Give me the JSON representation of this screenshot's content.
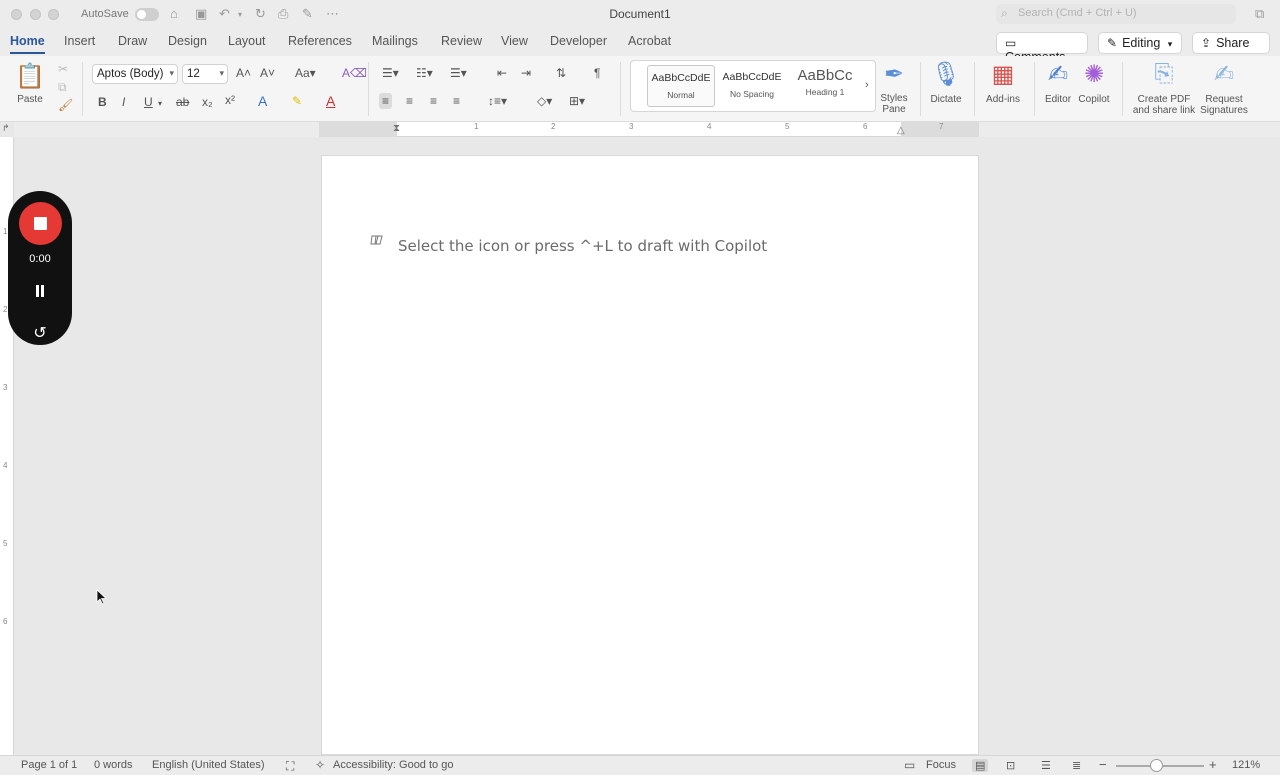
{
  "titlebar": {
    "autosave_label": "AutoSave",
    "document_title": "Document1",
    "search_placeholder": "Search (Cmd + Ctrl + U)"
  },
  "tabs": [
    "Home",
    "Insert",
    "Draw",
    "Design",
    "Layout",
    "References",
    "Mailings",
    "Review",
    "View",
    "Developer",
    "Acrobat"
  ],
  "active_tab": "Home",
  "header_actions": {
    "comments": "Comments",
    "editing": "Editing",
    "share": "Share"
  },
  "ribbon": {
    "paste_label": "Paste",
    "font_name": "Aptos (Body)",
    "font_size": "12",
    "styles": [
      {
        "sample": "AaBbCcDdE",
        "name": "Normal"
      },
      {
        "sample": "AaBbCcDdE",
        "name": "No Spacing"
      },
      {
        "sample": "AaBbCc",
        "name": "Heading 1"
      }
    ],
    "styles_pane_label": "Styles Pane",
    "dictate_label": "Dictate",
    "addins_label": "Add-ins",
    "editor_label": "Editor",
    "copilot_label": "Copilot",
    "create_pdf_label": "Create PDF and share link",
    "request_signatures_label": "Request Signatures"
  },
  "ruler": {
    "h_numbers": [
      "1",
      "2",
      "3",
      "4",
      "5",
      "6",
      "7"
    ],
    "v_numbers": [
      "1",
      "2",
      "3",
      "4",
      "5",
      "6"
    ]
  },
  "document": {
    "copilot_hint": "Select the icon or press ^+L to draft with Copilot"
  },
  "recorder": {
    "time": "0:00"
  },
  "statusbar": {
    "page": "Page 1 of 1",
    "words": "0 words",
    "language": "English (United States)",
    "accessibility": "Accessibility: Good to go",
    "focus": "Focus",
    "zoom": "121%",
    "zoom_level": 0.45
  }
}
